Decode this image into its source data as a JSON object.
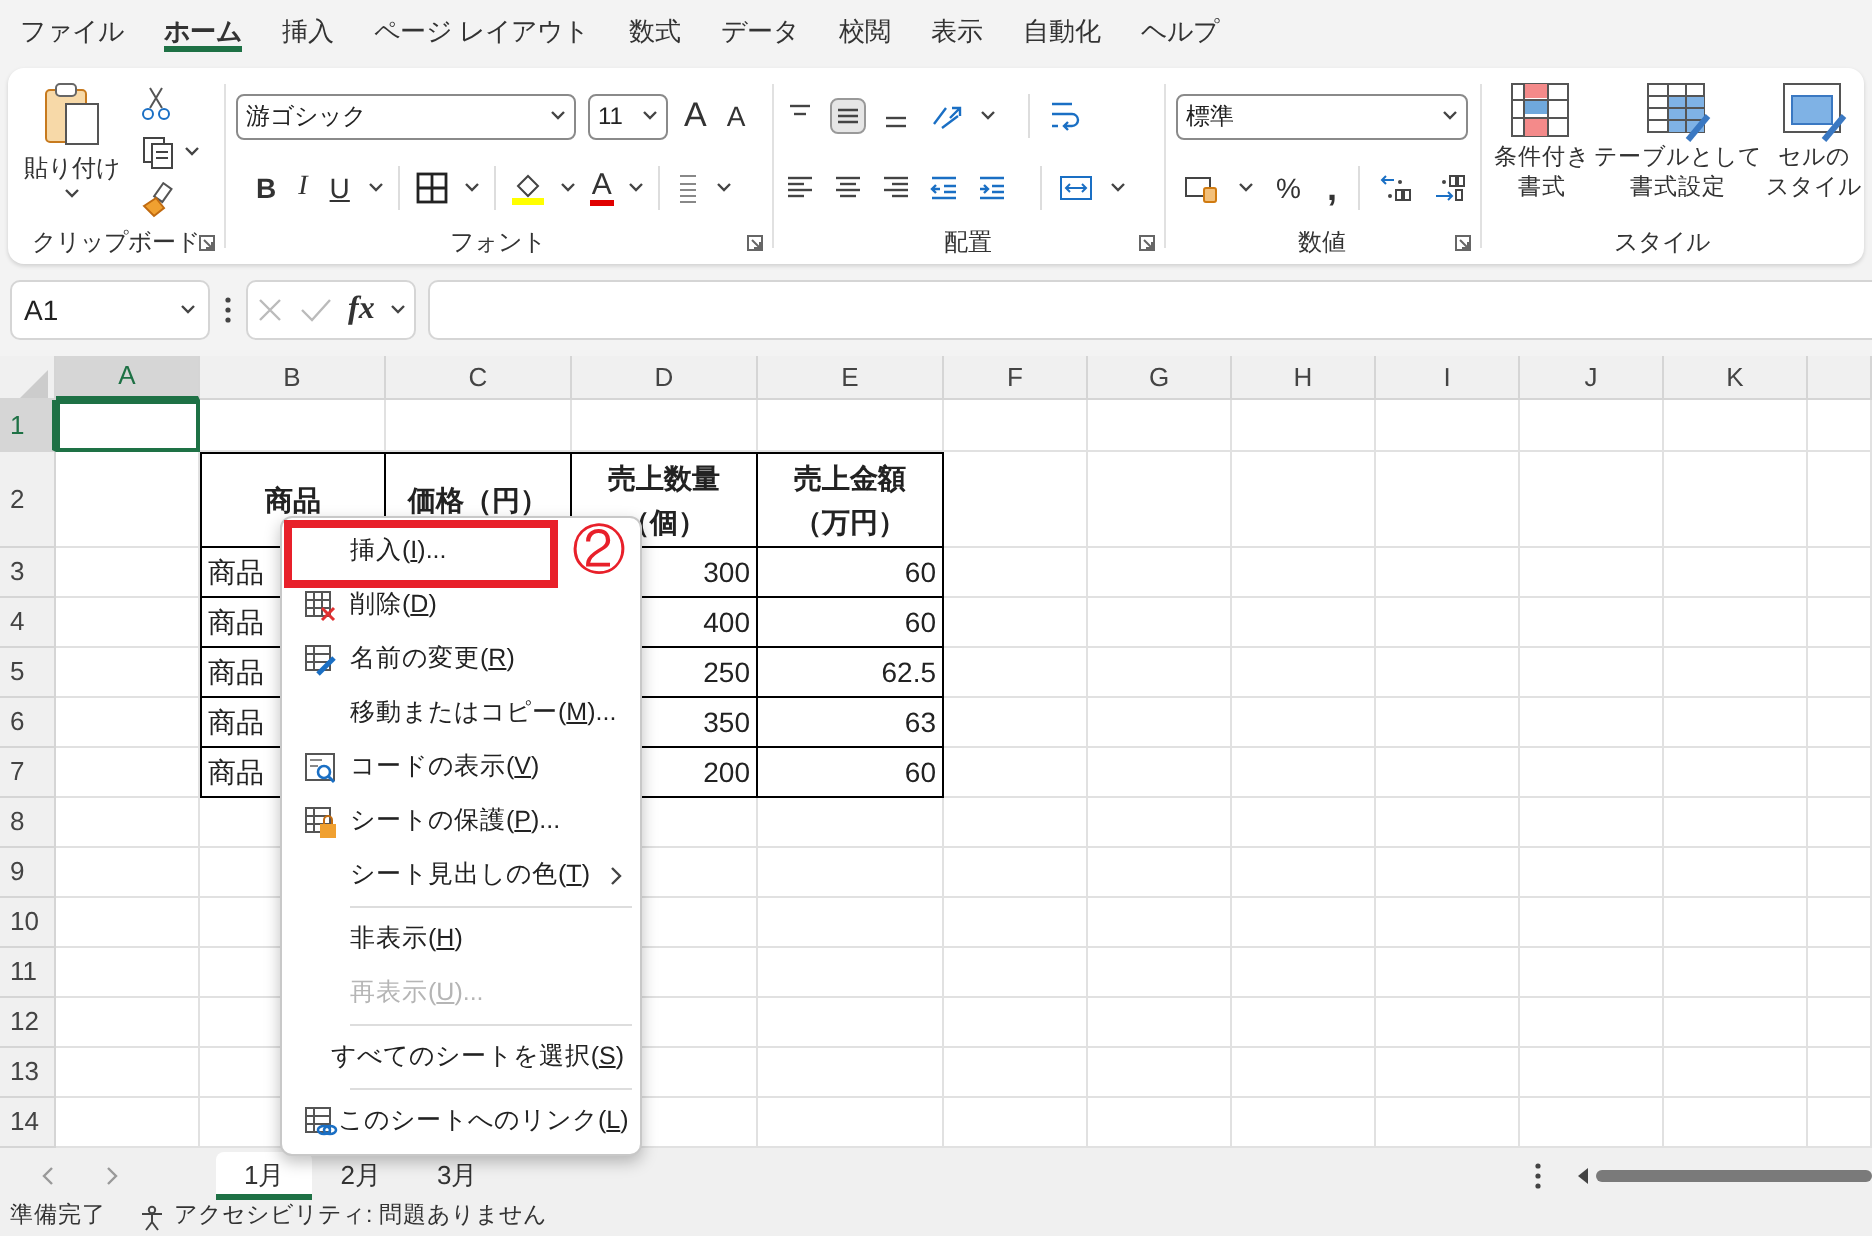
{
  "menu_tabs": [
    {
      "label": "ファイル",
      "selected": false
    },
    {
      "label": "ホーム",
      "selected": true
    },
    {
      "label": "挿入",
      "selected": false
    },
    {
      "label": "ページ レイアウト",
      "selected": false
    },
    {
      "label": "数式",
      "selected": false
    },
    {
      "label": "データ",
      "selected": false
    },
    {
      "label": "校閲",
      "selected": false
    },
    {
      "label": "表示",
      "selected": false
    },
    {
      "label": "自動化",
      "selected": false
    },
    {
      "label": "ヘルプ",
      "selected": false
    }
  ],
  "ribbon": {
    "groups": [
      {
        "kind": "clipboard",
        "label": "クリップボード",
        "paste": "貼り付け"
      },
      {
        "kind": "font",
        "label": "フォント",
        "font_name": "游ゴシック",
        "font_size": "11",
        "grow": "A",
        "shrink": "A",
        "bold": "B",
        "italic": "I",
        "underline": "U",
        "font_color": "A"
      },
      {
        "kind": "alignment",
        "label": "配置",
        "rows": [
          [
            {
              "kind": "top",
              "selected": false
            },
            {
              "kind": "middle",
              "selected": true
            },
            {
              "kind": "bottom",
              "selected": false
            },
            {
              "kind": "orientation",
              "selected": false
            },
            {
              "kind": "wrap",
              "selected": false
            }
          ],
          [
            {
              "kind": "left",
              "selected": false
            },
            {
              "kind": "center",
              "selected": false
            },
            {
              "kind": "right",
              "selected": false
            },
            {
              "kind": "outdent",
              "selected": false
            },
            {
              "kind": "indent",
              "selected": false
            },
            {
              "kind": "merge",
              "selected": false
            }
          ]
        ]
      },
      {
        "kind": "number",
        "label": "数値",
        "format": "標準",
        "percent": "%",
        "comma": ","
      },
      {
        "kind": "styles",
        "label": "スタイル",
        "buttons": [
          {
            "kind": "conditional",
            "label_lines": [
              "条件付き",
              "書式"
            ]
          },
          {
            "kind": "table",
            "label_lines": [
              "テーブルとして",
              "書式設定"
            ]
          },
          {
            "kind": "cell",
            "label_lines": [
              "セルの",
              "スタイル"
            ]
          }
        ]
      }
    ]
  },
  "formula_bar": {
    "name_box": "A1",
    "fx": "fx"
  },
  "sheet": {
    "columns": [
      {
        "label": "A",
        "selected": true
      },
      {
        "label": "B",
        "selected": false
      },
      {
        "label": "C",
        "selected": false
      },
      {
        "label": "D",
        "selected": false
      },
      {
        "label": "E",
        "selected": false
      },
      {
        "label": "F",
        "selected": false
      },
      {
        "label": "G",
        "selected": false
      },
      {
        "label": "H",
        "selected": false
      },
      {
        "label": "I",
        "selected": false
      },
      {
        "label": "J",
        "selected": false
      },
      {
        "label": "K",
        "selected": false
      }
    ],
    "rows": [
      {
        "label": "1",
        "selected": true
      },
      {
        "label": "2",
        "selected": false
      },
      {
        "label": "3",
        "selected": false
      },
      {
        "label": "4",
        "selected": false
      },
      {
        "label": "5",
        "selected": false
      },
      {
        "label": "6",
        "selected": false
      },
      {
        "label": "7",
        "selected": false
      },
      {
        "label": "8",
        "selected": false
      },
      {
        "label": "9",
        "selected": false
      },
      {
        "label": "10",
        "selected": false
      },
      {
        "label": "11",
        "selected": false
      },
      {
        "label": "12",
        "selected": false
      },
      {
        "label": "13",
        "selected": false
      },
      {
        "label": "14",
        "selected": false
      }
    ],
    "table": {
      "header": [
        "商品",
        "価格（円）",
        "売上数量（個）",
        "売上金額（万円）"
      ],
      "rows": [
        {
          "product": "商品",
          "quantity": "300",
          "amount": "60"
        },
        {
          "product": "商品",
          "quantity": "400",
          "amount": "60"
        },
        {
          "product": "商品",
          "quantity": "250",
          "amount": "62.5"
        },
        {
          "product": "商品",
          "quantity": "350",
          "amount": "63"
        },
        {
          "product": "商品",
          "quantity": "200",
          "amount": "60"
        }
      ]
    }
  },
  "context_menu": {
    "items": [
      {
        "kind": "plain",
        "before": "挿入(",
        "key": "I",
        "after": ")...",
        "disabled": false,
        "highlighted": true,
        "annotation": "②"
      },
      {
        "kind": "delete",
        "before": "削除(",
        "key": "D",
        "after": ")",
        "disabled": false,
        "highlighted": false
      },
      {
        "kind": "rename",
        "before": "名前の変更(",
        "key": "R",
        "after": ")",
        "disabled": false,
        "highlighted": false
      },
      {
        "kind": "plain",
        "before": "移動またはコピー(",
        "key": "M",
        "after": ")...",
        "disabled": false,
        "highlighted": false
      },
      {
        "kind": "view_code",
        "before": "コードの表示(",
        "key": "V",
        "after": ")",
        "disabled": false,
        "highlighted": false
      },
      {
        "kind": "protect",
        "before": "シートの保護(",
        "key": "P",
        "after": ")...",
        "disabled": false,
        "highlighted": false
      },
      {
        "kind": "submenu",
        "before": "シート見出しの色(",
        "key": "T",
        "after": ")",
        "disabled": false,
        "highlighted": false
      },
      {
        "kind": "separator"
      },
      {
        "kind": "plain",
        "before": "非表示(",
        "key": "H",
        "after": ")",
        "disabled": false,
        "highlighted": false
      },
      {
        "kind": "plain",
        "before": "再表示(",
        "key": "U",
        "after": ")...",
        "disabled": true,
        "highlighted": false
      },
      {
        "kind": "separator"
      },
      {
        "kind": "plain",
        "before": "すべてのシートを選択(",
        "key": "S",
        "after": ")",
        "disabled": false,
        "highlighted": false
      },
      {
        "kind": "separator"
      },
      {
        "kind": "link",
        "before": "このシートへのリンク(",
        "key": "L",
        "after": ")",
        "disabled": false,
        "highlighted": false
      }
    ]
  },
  "sheet_tabs": [
    {
      "label": "1月",
      "selected": true
    },
    {
      "label": "2月",
      "selected": false
    },
    {
      "label": "3月",
      "selected": false
    }
  ],
  "status_bar": {
    "ready": "準備完了",
    "accessibility": "アクセシビリティ: 問題ありません"
  }
}
